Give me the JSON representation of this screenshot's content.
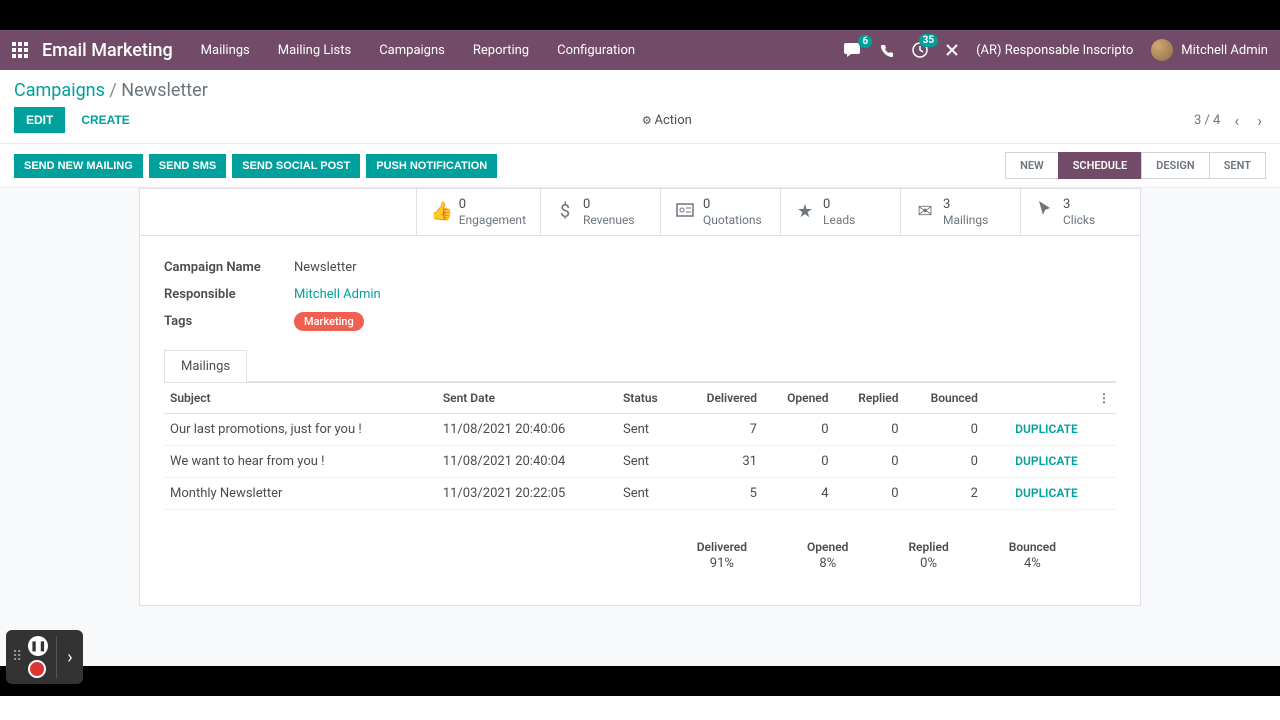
{
  "topbar": {
    "app_title": "Email Marketing",
    "nav": [
      "Mailings",
      "Mailing Lists",
      "Campaigns",
      "Reporting",
      "Configuration"
    ],
    "chat_badge": "6",
    "activity_badge": "35",
    "company": "(AR) Responsable Inscripto",
    "user_name": "Mitchell Admin"
  },
  "breadcrumb": {
    "root": "Campaigns",
    "current": "Newsletter"
  },
  "controls": {
    "edit": "EDIT",
    "create": "CREATE",
    "action": "Action",
    "pager": "3 / 4"
  },
  "action_buttons": [
    "SEND NEW MAILING",
    "SEND SMS",
    "SEND SOCIAL POST",
    "PUSH NOTIFICATION"
  ],
  "status_steps": [
    "NEW",
    "SCHEDULE",
    "DESIGN",
    "SENT"
  ],
  "stats": [
    {
      "icon": "thumb",
      "value": "0",
      "label": "Engagement"
    },
    {
      "icon": "dollar",
      "value": "0",
      "label": "Revenues"
    },
    {
      "icon": "quote",
      "value": "0",
      "label": "Quotations"
    },
    {
      "icon": "star",
      "value": "0",
      "label": "Leads"
    },
    {
      "icon": "envelope",
      "value": "3",
      "label": "Mailings"
    },
    {
      "icon": "cursor",
      "value": "3",
      "label": "Clicks"
    }
  ],
  "form": {
    "name_label": "Campaign Name",
    "name_value": "Newsletter",
    "resp_label": "Responsible",
    "resp_value": "Mitchell Admin",
    "tags_label": "Tags",
    "tags_value": "Marketing"
  },
  "tab": {
    "mailings": "Mailings"
  },
  "table": {
    "headers": {
      "subject": "Subject",
      "sent_date": "Sent Date",
      "status": "Status",
      "delivered": "Delivered",
      "opened": "Opened",
      "replied": "Replied",
      "bounced": "Bounced"
    },
    "rows": [
      {
        "subject": "Our last promotions, just for you !",
        "sent_date": "11/08/2021 20:40:06",
        "status": "Sent",
        "delivered": "7",
        "opened": "0",
        "replied": "0",
        "bounced": "0",
        "action": "DUPLICATE"
      },
      {
        "subject": "We want to hear from you !",
        "sent_date": "11/08/2021 20:40:04",
        "status": "Sent",
        "delivered": "31",
        "opened": "0",
        "replied": "0",
        "bounced": "0",
        "action": "DUPLICATE"
      },
      {
        "subject": "Monthly Newsletter",
        "sent_date": "11/03/2021 20:22:05",
        "status": "Sent",
        "delivered": "5",
        "opened": "4",
        "replied": "0",
        "bounced": "2",
        "action": "DUPLICATE"
      }
    ]
  },
  "totals": {
    "delivered_label": "Delivered",
    "delivered_val": "91%",
    "opened_label": "Opened",
    "opened_val": "8%",
    "replied_label": "Replied",
    "replied_val": "0%",
    "bounced_label": "Bounced",
    "bounced_val": "4%"
  }
}
